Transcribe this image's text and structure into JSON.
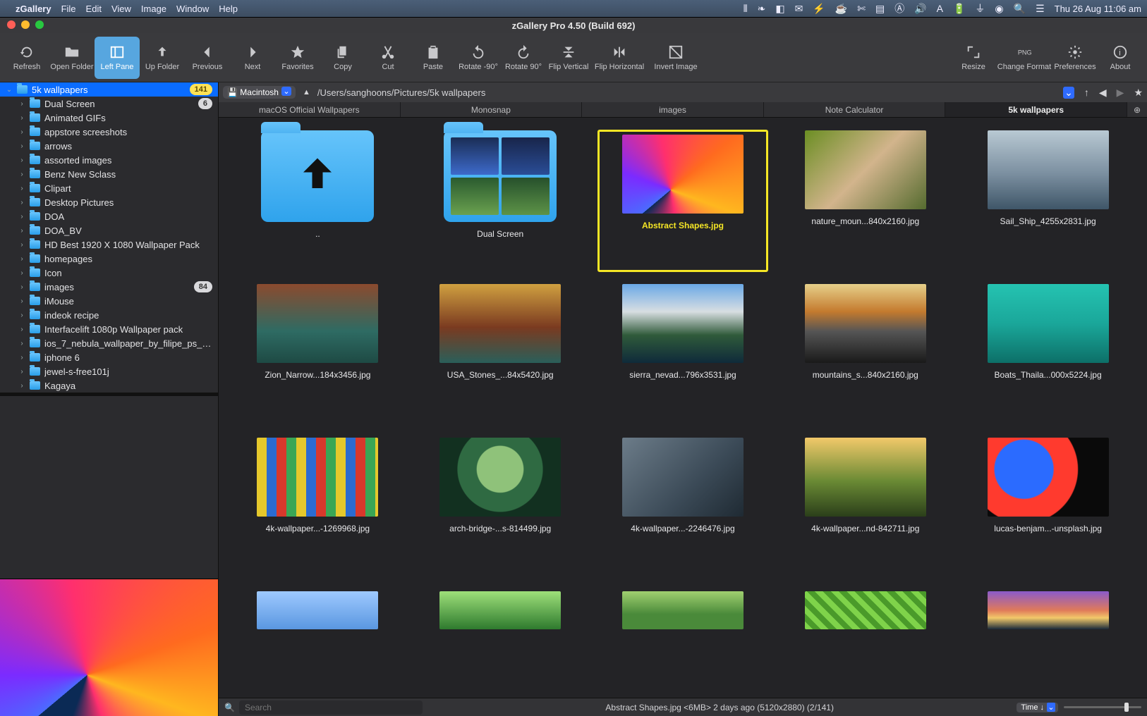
{
  "menubar": {
    "app": "zGallery",
    "items": [
      "File",
      "Edit",
      "View",
      "Image",
      "Window",
      "Help"
    ],
    "clock": "Thu 26 Aug  11:06 am"
  },
  "window_title": "zGallery Pro 4.50 (Build 692)",
  "toolbar": [
    {
      "id": "refresh",
      "label": "Refresh"
    },
    {
      "id": "open-folder",
      "label": "Open Folder"
    },
    {
      "id": "left-pane",
      "label": "Left Pane",
      "active": true
    },
    {
      "id": "up-folder",
      "label": "Up Folder"
    },
    {
      "id": "previous",
      "label": "Previous"
    },
    {
      "id": "next",
      "label": "Next"
    },
    {
      "id": "favorites",
      "label": "Favorites"
    },
    {
      "id": "copy",
      "label": "Copy"
    },
    {
      "id": "cut",
      "label": "Cut"
    },
    {
      "id": "paste",
      "label": "Paste"
    },
    {
      "id": "rotate-neg90",
      "label": "Rotate -90°"
    },
    {
      "id": "rotate-90",
      "label": "Rotate 90°"
    },
    {
      "id": "flip-vertical",
      "label": "Flip Vertical"
    },
    {
      "id": "flip-horizontal",
      "label": "Flip Horizontal"
    },
    {
      "id": "invert-image",
      "label": "Invert Image"
    },
    {
      "id": "resize",
      "label": "Resize"
    },
    {
      "id": "change-format",
      "label": "Change Format"
    },
    {
      "id": "preferences",
      "label": "Preferences"
    },
    {
      "id": "about",
      "label": "About"
    }
  ],
  "drive": "Macintosh",
  "path": "/Users/sanghoons/Pictures/5k wallpapers",
  "tree": [
    {
      "name": "5k wallpapers",
      "indent": 0,
      "open": true,
      "selected": true,
      "badge": "141"
    },
    {
      "name": "Dual Screen",
      "indent": 1,
      "badge": "6"
    },
    {
      "name": "Animated GIFs",
      "indent": 1
    },
    {
      "name": "appstore screeshots",
      "indent": 1
    },
    {
      "name": "arrows",
      "indent": 1
    },
    {
      "name": "assorted images",
      "indent": 1
    },
    {
      "name": "Benz New Sclass",
      "indent": 1
    },
    {
      "name": "Clipart",
      "indent": 1
    },
    {
      "name": "Desktop Pictures",
      "indent": 1
    },
    {
      "name": "DOA",
      "indent": 1
    },
    {
      "name": "DOA_BV",
      "indent": 1
    },
    {
      "name": "HD Best 1920 X 1080 Wallpaper Pack",
      "indent": 1
    },
    {
      "name": "homepages",
      "indent": 1
    },
    {
      "name": "Icon",
      "indent": 1
    },
    {
      "name": "images",
      "indent": 1,
      "badge": "84"
    },
    {
      "name": "iMouse",
      "indent": 1
    },
    {
      "name": "indeok recipe",
      "indent": 1
    },
    {
      "name": "Interfacelift 1080p Wallpaper pack",
      "indent": 1
    },
    {
      "name": "ios_7_nebula_wallpaper_by_filipe_ps_d...",
      "indent": 1
    },
    {
      "name": "iphone 6",
      "indent": 1
    },
    {
      "name": "jewel-s-free101j",
      "indent": 1
    },
    {
      "name": "Kagaya",
      "indent": 1
    }
  ],
  "tabs": [
    "macOS Official Wallpapers",
    "Monosnap",
    "images",
    "Note Calculator",
    "5k wallpapers"
  ],
  "active_tab": 4,
  "grid": [
    {
      "type": "up",
      "label": ".."
    },
    {
      "type": "folder",
      "label": "Dual Screen"
    },
    {
      "type": "image",
      "label": "Abstract Shapes.jpg",
      "selected": true,
      "bg": "bg-abstract"
    },
    {
      "type": "image",
      "label": "nature_moun...840x2160.jpg",
      "bg": "bg-nature"
    },
    {
      "type": "image",
      "label": "Sail_Ship_4255x2831.jpg",
      "bg": "bg-sail"
    },
    {
      "type": "image",
      "label": "Zion_Narrow...184x3456.jpg",
      "bg": "bg-zion"
    },
    {
      "type": "image",
      "label": "USA_Stones_...84x5420.jpg",
      "bg": "bg-usa"
    },
    {
      "type": "image",
      "label": "sierra_nevad...796x3531.jpg",
      "bg": "bg-sierra"
    },
    {
      "type": "image",
      "label": "mountains_s...840x2160.jpg",
      "bg": "bg-mount"
    },
    {
      "type": "image",
      "label": "Boats_Thaila...000x5224.jpg",
      "bg": "bg-boats"
    },
    {
      "type": "image",
      "label": "4k-wallpaper...-1269968.jpg",
      "bg": "bg-paint"
    },
    {
      "type": "image",
      "label": "arch-bridge-...s-814499.jpg",
      "bg": "bg-arch"
    },
    {
      "type": "image",
      "label": "4k-wallpaper...-2246476.jpg",
      "bg": "bg-city"
    },
    {
      "type": "image",
      "label": "4k-wallpaper...nd-842711.jpg",
      "bg": "bg-hills"
    },
    {
      "type": "image",
      "label": "lucas-benjam...-unsplash.jpg",
      "bg": "bg-ink"
    },
    {
      "type": "image",
      "label": "",
      "bg": "bg-sky",
      "short": true
    },
    {
      "type": "image",
      "label": "",
      "bg": "bg-green",
      "short": true
    },
    {
      "type": "image",
      "label": "",
      "bg": "bg-field",
      "short": true
    },
    {
      "type": "image",
      "label": "",
      "bg": "bg-leaf",
      "short": true
    },
    {
      "type": "image",
      "label": "",
      "bg": "bg-sunset",
      "short": true
    }
  ],
  "status": {
    "search_placeholder": "Search",
    "info": "Abstract Shapes.jpg <6MB> 2 days ago (5120x2880) (2/141)",
    "sort": "Time ↓"
  }
}
